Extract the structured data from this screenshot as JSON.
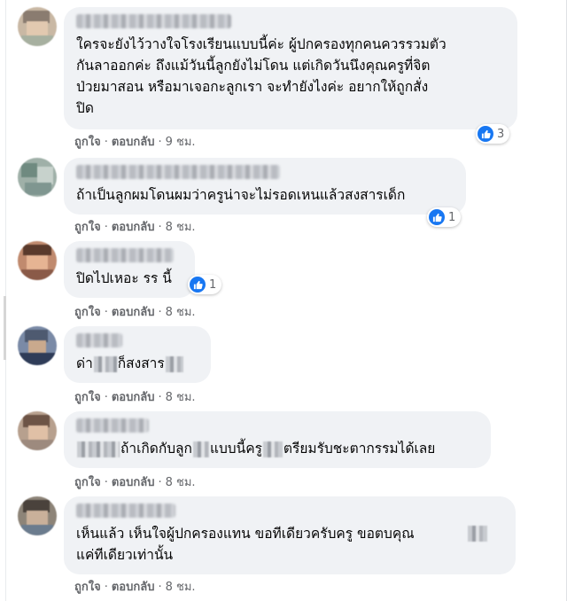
{
  "actions": {
    "like": "ถูกใจ",
    "reply": "ตอบกลับ",
    "dot": "·"
  },
  "colors": {
    "bubble": "#f0f2f5",
    "like_blue": "#1877f2",
    "meta_gray": "#65676b"
  },
  "comments": [
    {
      "text": "ใครจะยังไว้วางใจโรงเรียนแบบนี้ค่ะ ผู้ปกครองทุกคนควรรวมตัว\nกันลาออกค่ะ ถึงแม้วันนี้ลูกยังไม่โดน แต่เกิดวันนึงคุณครูที่จิต\nป่วยมาสอน หรือมาเจอกะลูกเรา จะทำยังไงค่ะ อยากให้ถูกสั่ง\nปิด",
      "time": "9 ชม.",
      "reactions": "3"
    },
    {
      "text": "ถ้าเป็นลูกผมโดนผมว่าครูน่าจะไม่รอดเหนแล้วสงสารเด็ก",
      "time": "8 ชม.",
      "reactions": "1"
    },
    {
      "text": "ปิดไปเหอะ รร นี้",
      "time": "8 ชม.",
      "reactions": "1"
    },
    {
      "text_a": "ด่า",
      "text_b": "ก็สงสาร",
      "time": "8 ชม."
    },
    {
      "text": "ถ้าเกิดกับลูก",
      "text_b": "แบบนี้ครู",
      "text_c": "ตรียมรับชะตากรรมได้เลย",
      "time": "8 ชม."
    },
    {
      "text": "เห็นแล้ว เห็นใจผู้ปกครองแทน ขอทีเดียวครับครู ขอตบคุณ\nแค่ทีเดียวเท่านั้น",
      "time": "8 ชม."
    }
  ]
}
